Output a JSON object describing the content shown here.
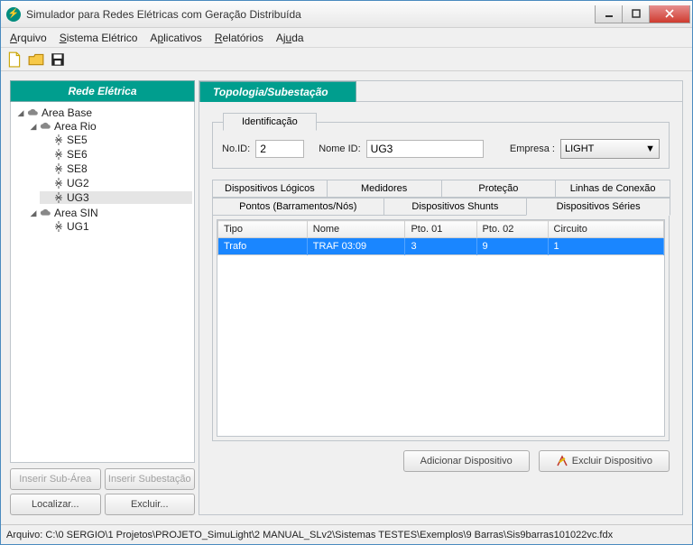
{
  "window": {
    "title": "Simulador para Redes Elétricas com Geração Distribuída"
  },
  "menu": {
    "arquivo": "Arquivo",
    "sistema": "Sistema Elétrico",
    "aplicativos": "Aplicativos",
    "relatorios": "Relatórios",
    "ajuda": "Ajuda"
  },
  "left": {
    "header": "Rede Elétrica",
    "root": "Area Base",
    "area_rio": "Area Rio",
    "rio_children": [
      "SE5",
      "SE6",
      "SE8",
      "UG2",
      "UG3"
    ],
    "area_sin": "Area SIN",
    "sin_children": [
      "UG1"
    ],
    "buttons": {
      "inserir_subarea": "Inserir Sub-Área",
      "inserir_subestacao": "Inserir Subestação",
      "localizar": "Localizar...",
      "excluir": "Excluir..."
    }
  },
  "right": {
    "section_title": "Topologia/Subestação",
    "ident_tab": "Identificação",
    "labels": {
      "noid": "No.ID:",
      "nomeid": "Nome ID:",
      "empresa": "Empresa :"
    },
    "values": {
      "noid": "2",
      "nomeid": "UG3",
      "empresa": "LIGHT"
    },
    "subtabs_row1": [
      "Dispositivos Lógicos",
      "Medidores",
      "Proteção",
      "Linhas de Conexão"
    ],
    "subtabs_row2": [
      "Pontos (Barramentos/Nós)",
      "Dispositivos Shunts",
      "Dispositivos Séries"
    ],
    "active_subtab": "Dispositivos Séries",
    "table": {
      "headers": [
        "Tipo",
        "Nome",
        "Pto. 01",
        "Pto. 02",
        "Circuito"
      ],
      "rows": [
        {
          "tipo": "Trafo",
          "nome": "TRAF 03:09",
          "pto1": "3",
          "pto2": "9",
          "circuito": "1",
          "selected": true
        }
      ]
    },
    "buttons": {
      "adicionar": "Adicionar Dispositivo",
      "excluir": "Excluir Dispositivo"
    }
  },
  "status": {
    "text": "Arquivo: C:\\0 SERGIO\\1 Projetos\\PROJETO_SimuLight\\2 MANUAL_SLv2\\Sistemas TESTES\\Exemplos\\9 Barras\\Sis9barras101022vc.fdx"
  }
}
